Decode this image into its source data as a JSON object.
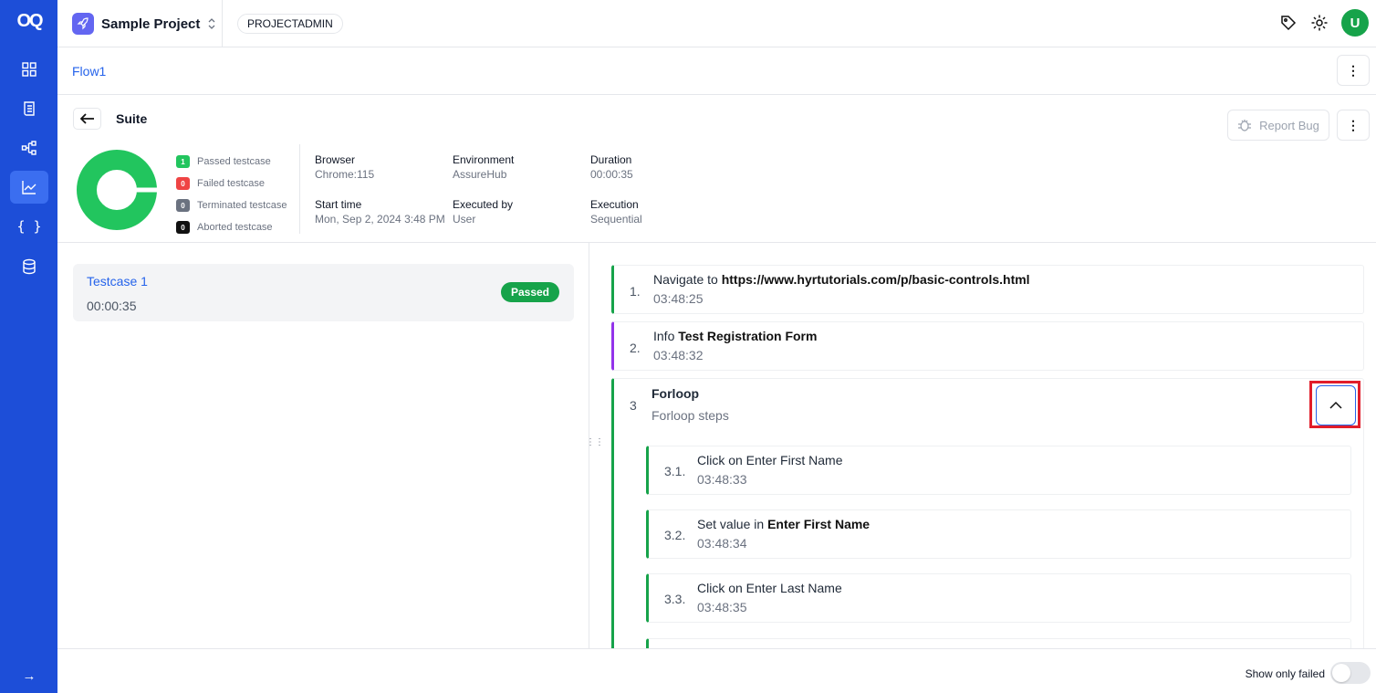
{
  "sidebar": {
    "logo": "OQ",
    "items": [
      {
        "icon": "dashboard-grid-icon"
      },
      {
        "icon": "scroll-test-icon"
      },
      {
        "icon": "flow-nodes-icon"
      },
      {
        "icon": "chart-line-icon",
        "active": true
      },
      {
        "icon": "curly-braces-icon",
        "text": "{ }"
      },
      {
        "icon": "database-icon"
      }
    ],
    "expand_icon": "→"
  },
  "header": {
    "project_name": "Sample Project",
    "role": "PROJECTADMIN",
    "avatar_letter": "U"
  },
  "flow": {
    "title": "Flow1"
  },
  "suite": {
    "title": "Suite",
    "report_bug_label": "Report Bug",
    "legend": [
      {
        "count": "1",
        "label": "Passed testcase",
        "color": "#22c55e"
      },
      {
        "count": "0",
        "label": "Failed testcase",
        "color": "#ef4444"
      },
      {
        "count": "0",
        "label": "Terminated testcase",
        "color": "#6b7280"
      },
      {
        "count": "0",
        "label": "Aborted testcase",
        "color": "#111111"
      }
    ],
    "meta": {
      "browser_label": "Browser",
      "browser": "Chrome:115",
      "environment_label": "Environment",
      "environment": "AssureHub",
      "duration_label": "Duration",
      "duration": "00:00:35",
      "start_label": "Start time",
      "start": "Mon, Sep 2, 2024 3:48 PM",
      "executed_by_label": "Executed by",
      "executed_by": "User",
      "execution_label": "Execution",
      "execution": "Sequential"
    }
  },
  "testcase": {
    "name": "Testcase 1",
    "duration": "00:00:35",
    "status": "Passed"
  },
  "steps": [
    {
      "num": "1.",
      "prefix": "Navigate to ",
      "bold": "https://www.hyrtutorials.com/p/basic-controls.html",
      "time": "03:48:25",
      "color": "#16a34a"
    },
    {
      "num": "2.",
      "prefix": "Info ",
      "bold": "Test Registration Form",
      "time": "03:48:32",
      "color": "#9333ea"
    },
    {
      "num": "3",
      "title": "Forloop",
      "subtitle": "Forloop steps",
      "color": "#16a34a"
    }
  ],
  "substeps": [
    {
      "num": "3.1.",
      "prefix": "Click on Enter First Name",
      "bold": "",
      "time": "03:48:33"
    },
    {
      "num": "3.2.",
      "prefix": "Set value in ",
      "bold": "Enter First Name",
      "time": "03:48:34"
    },
    {
      "num": "3.3.",
      "prefix": "Click on Enter Last Name",
      "bold": "",
      "time": "03:48:35"
    }
  ],
  "footer": {
    "show_only_failed_label": "Show only failed",
    "show_only_failed": false
  }
}
